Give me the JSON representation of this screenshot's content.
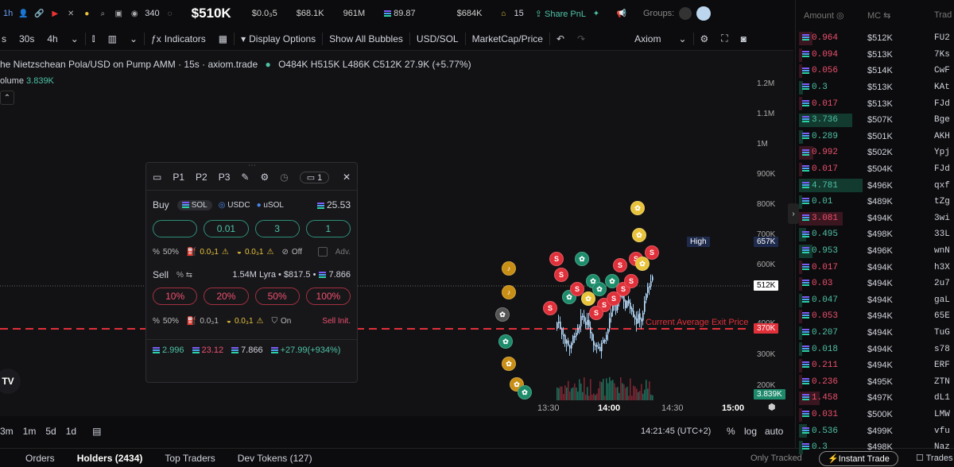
{
  "topbar": {
    "timeframe": "1h",
    "count_340": "340",
    "market_cap": "$510K",
    "price": "$0.0₃5",
    "liquidity": "$68.1K",
    "supply": "961M",
    "sol_stat": "89.87",
    "stat_684": "$684K",
    "bell_count": "15",
    "share_label": "Share PnL",
    "groups_label": "Groups:"
  },
  "toolbar": {
    "tf_30s": "30s",
    "tf_4h": "4h",
    "tf_s": "s",
    "indicators": "Indicators",
    "display_options": "Display Options",
    "show_bubbles": "Show All Bubbles",
    "pair": "USD/SOL",
    "metric": "MarketCap/Price",
    "source": "Axiom"
  },
  "chart": {
    "title": "he Nietzschean Pola/USD on Pump AMM · 15s · axiom.trade",
    "ohlc": "O484K H515K L486K C512K 27.9K (+5.77%)",
    "volume_label": "olume",
    "volume_value": "3.839K",
    "y_ticks": [
      "1.2M",
      "1.1M",
      "1M",
      "900K",
      "800K",
      "700K",
      "600K",
      "400K",
      "300K",
      "200K"
    ],
    "high_label": "High",
    "high_value": "657K",
    "current_value": "512K",
    "exit_label": "Current Average Exit Price",
    "exit_value": "370K",
    "volume_axis": "3.839K",
    "x_ticks": [
      "13:30",
      "14:00",
      "14:30",
      "15:00"
    ]
  },
  "bottom": {
    "ranges": [
      "3m",
      "1m",
      "5d",
      "1d"
    ],
    "clock": "14:21:45 (UTC+2)",
    "pct": "%",
    "log": "log",
    "auto": "auto"
  },
  "tabs": {
    "orders": "Orders",
    "holders": "Holders (2434)",
    "top_traders": "Top Traders",
    "dev_tokens": "Dev Tokens (127)",
    "only_tracked": "Only Tracked",
    "instant_trade": "Instant Trade",
    "trades": "Trades"
  },
  "panel": {
    "presets": [
      "P1",
      "P2",
      "P3"
    ],
    "tab_count": "1",
    "buy_label": "Buy",
    "currencies": [
      "SOL",
      "USDC",
      "uSOL"
    ],
    "buy_balance": "25.53",
    "buy_amounts": [
      "",
      "0.01",
      "3",
      "1"
    ],
    "buy_settings": [
      "50%",
      "0.0₃1",
      "0.0₃1",
      "Off",
      "Adv."
    ],
    "sell_label": "Sell",
    "sell_info": "1.54M Lyra • $817.5 •",
    "sell_balance": "7.866",
    "sell_pcts": [
      "10%",
      "20%",
      "50%",
      "100%"
    ],
    "sell_settings": [
      "50%",
      "0.0₃1",
      "0.0₃1",
      "On",
      "Sell Init."
    ],
    "footer": [
      "2.996",
      "23.12",
      "7.866",
      "+27.99(+934%)"
    ]
  },
  "sidebar": {
    "headers": [
      "Amount",
      "MC",
      "Trad"
    ],
    "rows": [
      {
        "amt": "0.964",
        "mc": "$512K",
        "tr": "FU2",
        "side": "sell"
      },
      {
        "amt": "0.094",
        "mc": "$513K",
        "tr": "7Ks",
        "side": "sell"
      },
      {
        "amt": "0.056",
        "mc": "$514K",
        "tr": "CwF",
        "side": "sell"
      },
      {
        "amt": "0.3",
        "mc": "$513K",
        "tr": "KAt",
        "side": "buy"
      },
      {
        "amt": "0.017",
        "mc": "$513K",
        "tr": "FJd",
        "side": "sell"
      },
      {
        "amt": "3.736",
        "mc": "$507K",
        "tr": "Bge",
        "side": "buy"
      },
      {
        "amt": "0.289",
        "mc": "$501K",
        "tr": "AKH",
        "side": "buy"
      },
      {
        "amt": "0.992",
        "mc": "$502K",
        "tr": "Ypj",
        "side": "sell"
      },
      {
        "amt": "0.017",
        "mc": "$504K",
        "tr": "FJd",
        "side": "sell"
      },
      {
        "amt": "4.781",
        "mc": "$496K",
        "tr": "qxf",
        "side": "buy"
      },
      {
        "amt": "0.01",
        "mc": "$489K",
        "tr": "tZg",
        "side": "buy"
      },
      {
        "amt": "3.081",
        "mc": "$494K",
        "tr": "3wi",
        "side": "sell"
      },
      {
        "amt": "0.495",
        "mc": "$498K",
        "tr": "33L",
        "side": "buy"
      },
      {
        "amt": "0.953",
        "mc": "$496K",
        "tr": "wnN",
        "side": "buy"
      },
      {
        "amt": "0.017",
        "mc": "$494K",
        "tr": "h3X",
        "side": "sell"
      },
      {
        "amt": "0.03",
        "mc": "$494K",
        "tr": "2u7",
        "side": "sell"
      },
      {
        "amt": "0.047",
        "mc": "$494K",
        "tr": "gaL",
        "side": "buy"
      },
      {
        "amt": "0.053",
        "mc": "$494K",
        "tr": "65E",
        "side": "sell"
      },
      {
        "amt": "0.207",
        "mc": "$494K",
        "tr": "TuG",
        "side": "buy"
      },
      {
        "amt": "0.018",
        "mc": "$494K",
        "tr": "s78",
        "side": "buy"
      },
      {
        "amt": "0.211",
        "mc": "$494K",
        "tr": "ERF",
        "side": "sell"
      },
      {
        "amt": "0.236",
        "mc": "$495K",
        "tr": "ZTN",
        "side": "sell"
      },
      {
        "amt": "1.458",
        "mc": "$497K",
        "tr": "dL1",
        "side": "sell"
      },
      {
        "amt": "0.031",
        "mc": "$500K",
        "tr": "LMW",
        "side": "sell"
      },
      {
        "amt": "0.536",
        "mc": "$499K",
        "tr": "vfu",
        "side": "buy"
      },
      {
        "amt": "0.3",
        "mc": "$498K",
        "tr": "Naz",
        "side": "buy"
      }
    ]
  },
  "colors": {
    "buy": "#4ec2a5",
    "sell": "#f0506e",
    "bg": "#0c0c0e"
  }
}
